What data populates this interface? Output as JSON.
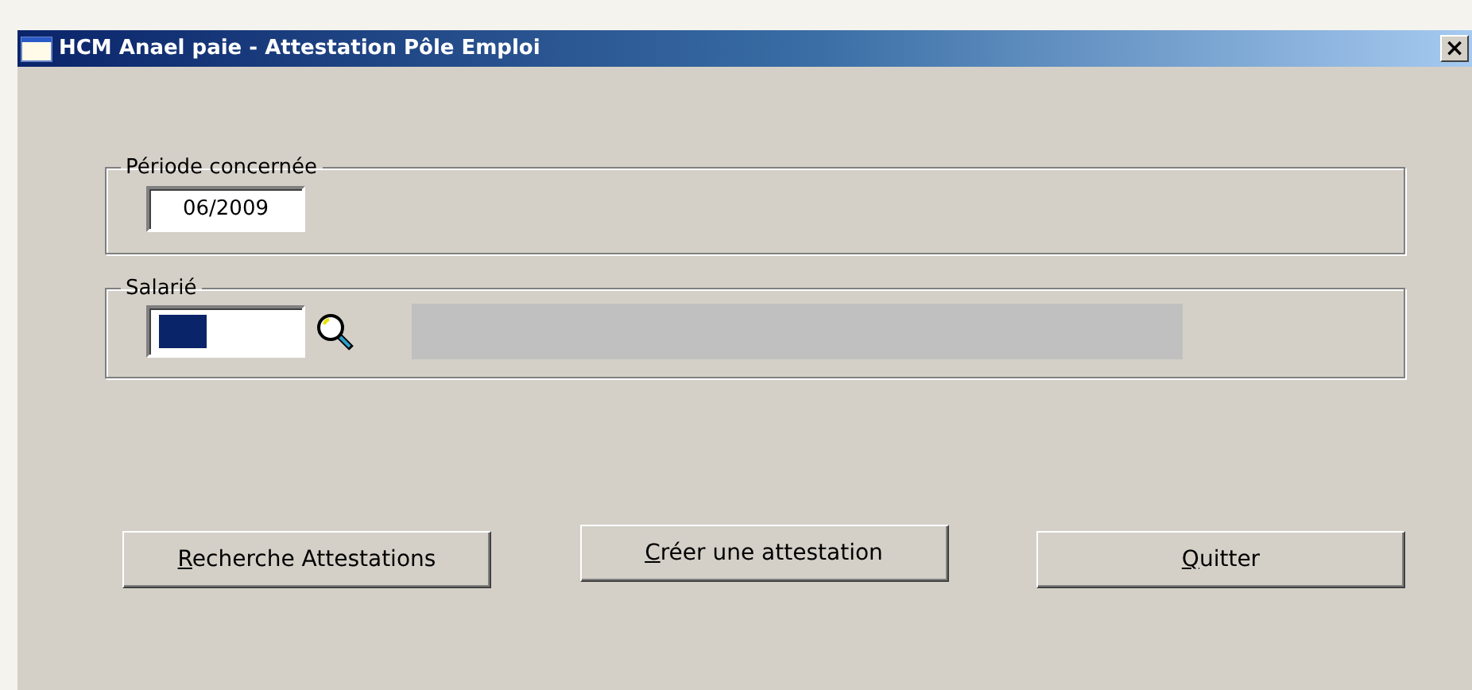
{
  "window": {
    "title": "HCM Anael paie - Attestation Pôle Emploi",
    "close": "×"
  },
  "periode": {
    "legend": "Période concernée",
    "value": "06/2009"
  },
  "salarie": {
    "legend": "Salarié",
    "text_selected": true,
    "name_disabled": true
  },
  "buttons": [
    {
      "label": "Recherche Attestations",
      "mnemonic_first": true
    },
    {
      "label": "Créer une attestation",
      "mnemonic_first": true
    },
    {
      "label": "Quitter",
      "mnemonic_first": true
    }
  ]
}
